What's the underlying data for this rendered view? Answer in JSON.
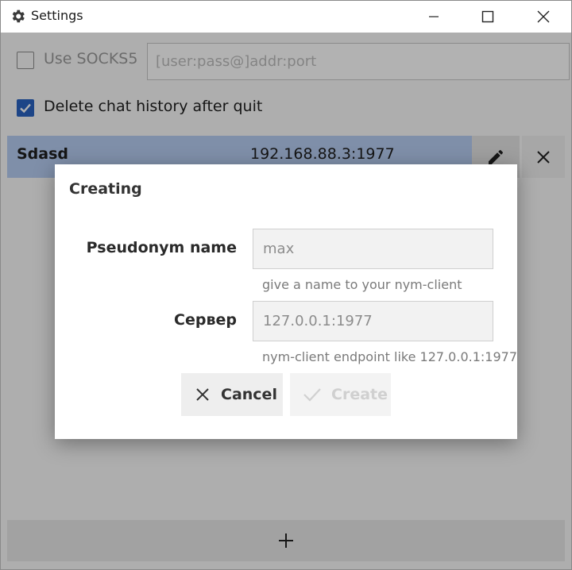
{
  "window": {
    "title": "Settings"
  },
  "settings": {
    "socks5_label": "Use SOCKS5",
    "socks5_checked": false,
    "socks5_placeholder": "[user:pass@]addr:port",
    "delete_history_label": "Delete chat history after quit",
    "delete_history_checked": true
  },
  "servers": [
    {
      "name": "Sdasd",
      "address": "192.168.88.3:1977"
    }
  ],
  "dialog": {
    "title": "Creating",
    "pseudonym_label": "Pseudonym name",
    "pseudonym_value": "max",
    "pseudonym_hint": "give a name to your nym-client",
    "server_label": "Сервер",
    "server_value": "127.0.0.1:1977",
    "server_hint": "nym-client endpoint like 127.0.0.1:1977",
    "cancel_label": "Cancel",
    "create_label": "Create"
  },
  "colors": {
    "accent": "#2a63c2",
    "selected_row": "#b7cdf2"
  },
  "icons": {
    "title": "gear-icon",
    "edit": "pencil-icon",
    "remove": "close-icon",
    "add": "plus-icon",
    "cancel": "close-icon",
    "create": "check-icon"
  }
}
